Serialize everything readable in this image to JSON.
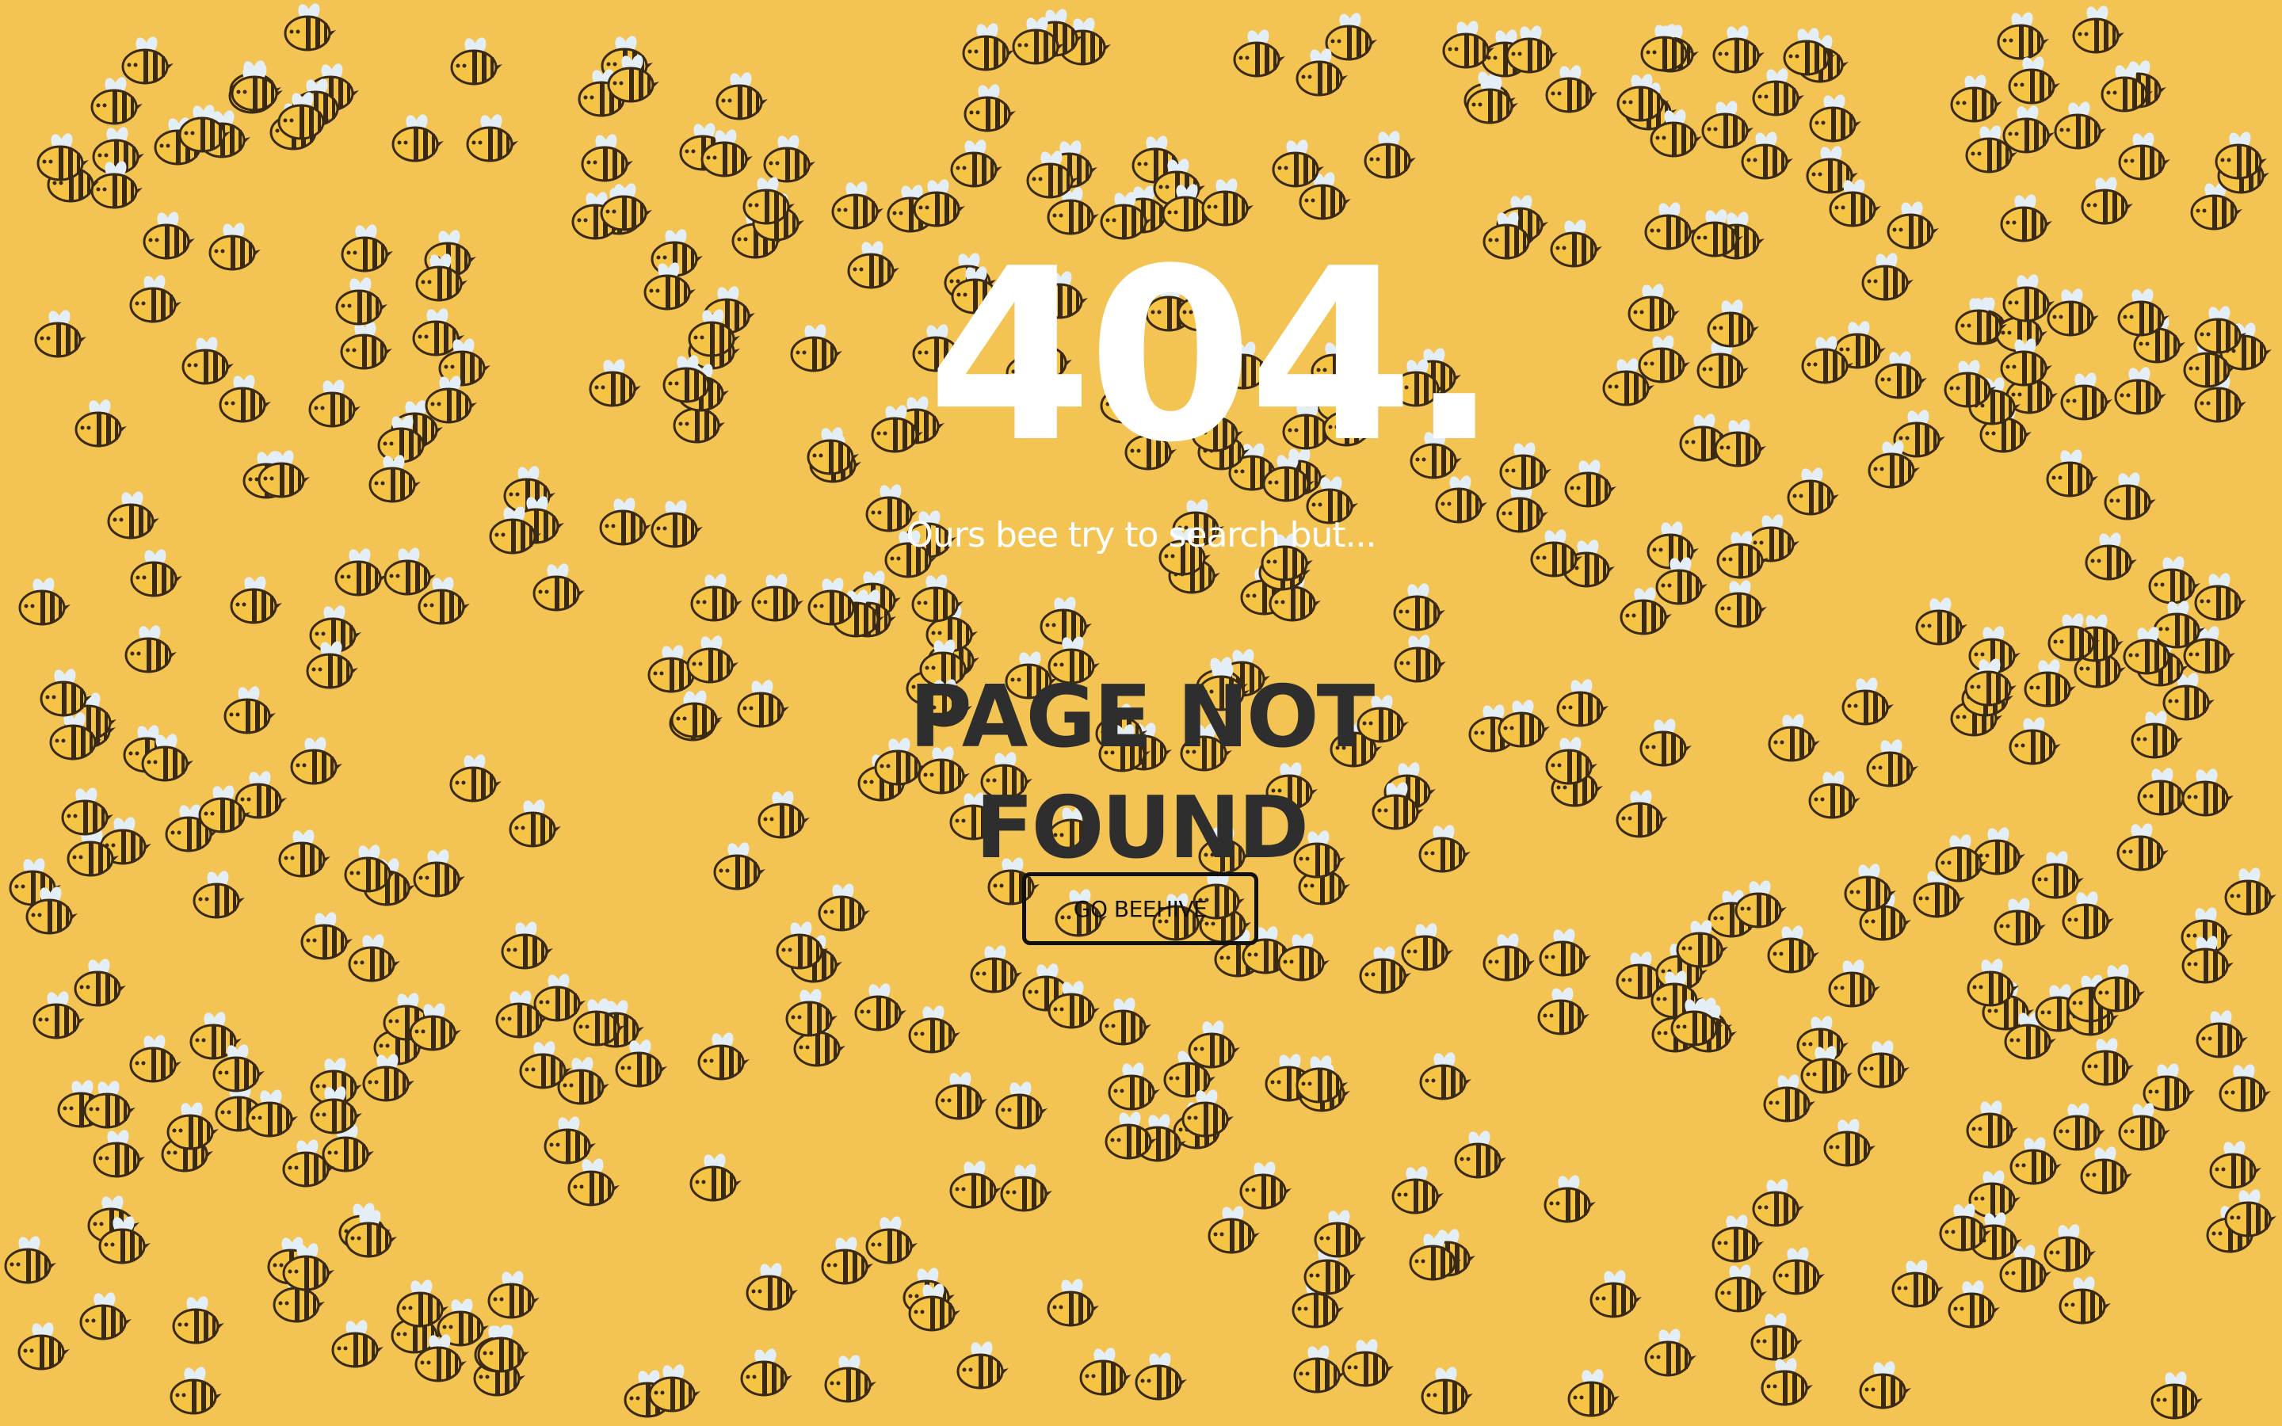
{
  "error_page": {
    "code": "404.",
    "subtitle": "Ours bee try to search but...",
    "headline": "PAGE NOT FOUND",
    "button_label": "GO BEEHIVE"
  },
  "theme": {
    "background": "#f3c454",
    "code_color": "#ffffff",
    "headline_color": "#2e2e2e",
    "button_border": "#111111",
    "bee_body": "#f6c445",
    "bee_stripe": "#3a2a14",
    "bee_wing": "#e4eef7"
  },
  "decoration": {
    "icon": "bee-icon"
  }
}
